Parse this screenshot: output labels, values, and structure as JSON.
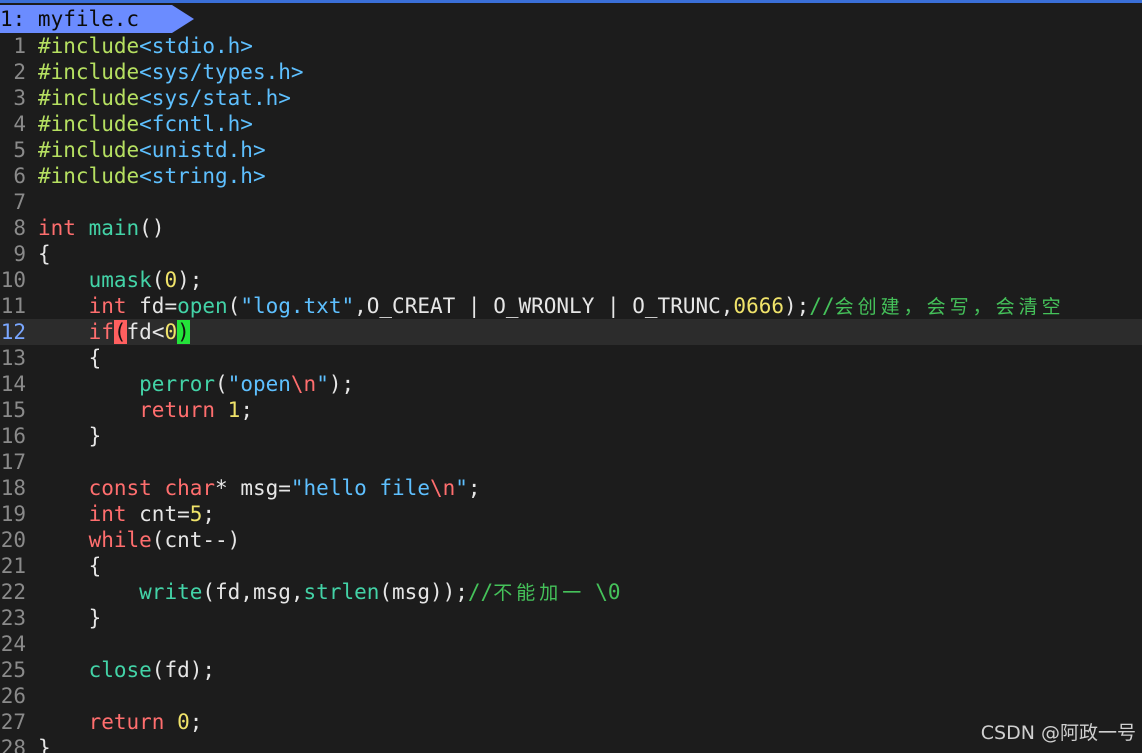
{
  "tab": {
    "label": "1: myfile.c"
  },
  "editor": {
    "current_line": "12",
    "lines": [
      {
        "n": "1",
        "code": [
          {
            "c": "t-pp",
            "t": "#include"
          },
          {
            "c": "t-str",
            "t": "<stdio.h>"
          }
        ]
      },
      {
        "n": "2",
        "code": [
          {
            "c": "t-pp",
            "t": "#include"
          },
          {
            "c": "t-str",
            "t": "<sys/types.h>"
          }
        ]
      },
      {
        "n": "3",
        "code": [
          {
            "c": "t-pp",
            "t": "#include"
          },
          {
            "c": "t-str",
            "t": "<sys/stat.h>"
          }
        ]
      },
      {
        "n": "4",
        "code": [
          {
            "c": "t-pp",
            "t": "#include"
          },
          {
            "c": "t-str",
            "t": "<fcntl.h>"
          }
        ]
      },
      {
        "n": "5",
        "code": [
          {
            "c": "t-pp",
            "t": "#include"
          },
          {
            "c": "t-str",
            "t": "<unistd.h>"
          }
        ]
      },
      {
        "n": "6",
        "code": [
          {
            "c": "t-pp",
            "t": "#include"
          },
          {
            "c": "t-str",
            "t": "<string.h>"
          }
        ]
      },
      {
        "n": "7",
        "code": []
      },
      {
        "n": "8",
        "code": [
          {
            "c": "t-kw",
            "t": "int"
          },
          {
            "c": "t-op",
            "t": " "
          },
          {
            "c": "t-fn",
            "t": "main"
          },
          {
            "c": "t-op",
            "t": "()"
          }
        ]
      },
      {
        "n": "9",
        "code": [
          {
            "c": "t-op",
            "t": "{"
          }
        ]
      },
      {
        "n": "10",
        "code": [
          {
            "c": "t-op",
            "t": "    "
          },
          {
            "c": "t-fn",
            "t": "umask"
          },
          {
            "c": "t-op",
            "t": "("
          },
          {
            "c": "t-num",
            "t": "0"
          },
          {
            "c": "t-op",
            "t": ");"
          }
        ]
      },
      {
        "n": "11",
        "code": [
          {
            "c": "t-op",
            "t": "    "
          },
          {
            "c": "t-kw",
            "t": "int"
          },
          {
            "c": "t-op",
            "t": " fd="
          },
          {
            "c": "t-fn",
            "t": "open"
          },
          {
            "c": "t-op",
            "t": "("
          },
          {
            "c": "t-str",
            "t": "\"log.txt\""
          },
          {
            "c": "t-op",
            "t": ",O_CREAT | O_WRONLY | O_TRUNC,"
          },
          {
            "c": "t-num",
            "t": "0666"
          },
          {
            "c": "t-op",
            "t": ");"
          },
          {
            "c": "t-cm-mono",
            "t": "//"
          },
          {
            "c": "t-cm",
            "t": "会创建，会写，会清空"
          }
        ]
      },
      {
        "n": "12",
        "code": [
          {
            "c": "t-op",
            "t": "    "
          },
          {
            "c": "t-kw",
            "t": "if"
          },
          {
            "c": "match-red",
            "t": "("
          },
          {
            "c": "t-op",
            "t": "fd<"
          },
          {
            "c": "t-num",
            "t": "0"
          },
          {
            "c": "match-green",
            "t": ")"
          }
        ]
      },
      {
        "n": "13",
        "code": [
          {
            "c": "t-op",
            "t": "    {"
          }
        ]
      },
      {
        "n": "14",
        "code": [
          {
            "c": "t-op",
            "t": "        "
          },
          {
            "c": "t-fn",
            "t": "perror"
          },
          {
            "c": "t-op",
            "t": "("
          },
          {
            "c": "t-str",
            "t": "\"open"
          },
          {
            "c": "t-esc",
            "t": "\\n"
          },
          {
            "c": "t-str",
            "t": "\""
          },
          {
            "c": "t-op",
            "t": ");"
          }
        ]
      },
      {
        "n": "15",
        "code": [
          {
            "c": "t-op",
            "t": "        "
          },
          {
            "c": "t-kw",
            "t": "return"
          },
          {
            "c": "t-op",
            "t": " "
          },
          {
            "c": "t-num",
            "t": "1"
          },
          {
            "c": "t-op",
            "t": ";"
          }
        ]
      },
      {
        "n": "16",
        "code": [
          {
            "c": "t-op",
            "t": "    }"
          }
        ]
      },
      {
        "n": "17",
        "code": []
      },
      {
        "n": "18",
        "code": [
          {
            "c": "t-op",
            "t": "    "
          },
          {
            "c": "t-kw",
            "t": "const"
          },
          {
            "c": "t-op",
            "t": " "
          },
          {
            "c": "t-kw",
            "t": "char"
          },
          {
            "c": "t-op",
            "t": "* msg="
          },
          {
            "c": "t-str",
            "t": "\"hello file"
          },
          {
            "c": "t-esc",
            "t": "\\n"
          },
          {
            "c": "t-str",
            "t": "\""
          },
          {
            "c": "t-op",
            "t": ";"
          }
        ]
      },
      {
        "n": "19",
        "code": [
          {
            "c": "t-op",
            "t": "    "
          },
          {
            "c": "t-kw",
            "t": "int"
          },
          {
            "c": "t-op",
            "t": " cnt="
          },
          {
            "c": "t-num",
            "t": "5"
          },
          {
            "c": "t-op",
            "t": ";"
          }
        ]
      },
      {
        "n": "20",
        "code": [
          {
            "c": "t-op",
            "t": "    "
          },
          {
            "c": "t-kw",
            "t": "while"
          },
          {
            "c": "t-op",
            "t": "(cnt--)"
          }
        ]
      },
      {
        "n": "21",
        "code": [
          {
            "c": "t-op",
            "t": "    {"
          }
        ]
      },
      {
        "n": "22",
        "code": [
          {
            "c": "t-op",
            "t": "        "
          },
          {
            "c": "t-fn",
            "t": "write"
          },
          {
            "c": "t-op",
            "t": "(fd,msg,"
          },
          {
            "c": "t-fn",
            "t": "strlen"
          },
          {
            "c": "t-op",
            "t": "(msg));"
          },
          {
            "c": "t-cm-mono",
            "t": "//"
          },
          {
            "c": "t-cm",
            "t": "不能加一 "
          },
          {
            "c": "t-cm-mono",
            "t": "\\0"
          }
        ]
      },
      {
        "n": "23",
        "code": [
          {
            "c": "t-op",
            "t": "    }"
          }
        ]
      },
      {
        "n": "24",
        "code": []
      },
      {
        "n": "25",
        "code": [
          {
            "c": "t-op",
            "t": "    "
          },
          {
            "c": "t-fn",
            "t": "close"
          },
          {
            "c": "t-op",
            "t": "(fd);"
          }
        ]
      },
      {
        "n": "26",
        "code": []
      },
      {
        "n": "27",
        "code": [
          {
            "c": "t-op",
            "t": "    "
          },
          {
            "c": "t-kw",
            "t": "return"
          },
          {
            "c": "t-op",
            "t": " "
          },
          {
            "c": "t-num",
            "t": "0"
          },
          {
            "c": "t-op",
            "t": ";"
          }
        ]
      },
      {
        "n": "28",
        "code": [
          {
            "c": "t-op",
            "t": "}"
          }
        ]
      }
    ]
  },
  "watermark": "CSDN @阿政一号"
}
